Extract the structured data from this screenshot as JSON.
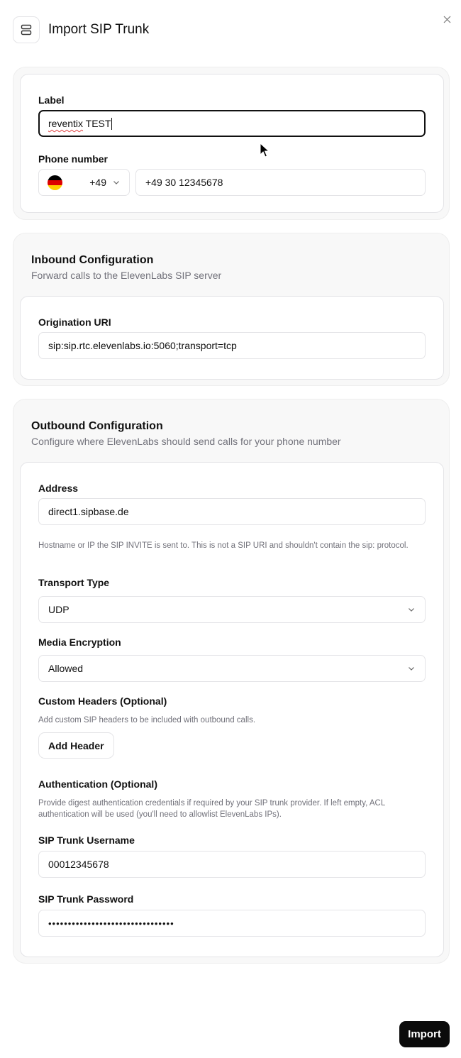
{
  "header": {
    "title": "Import SIP Trunk",
    "icon": "server-icon",
    "close_icon": "close-icon"
  },
  "basic": {
    "label_label": "Label",
    "label_value_word": "reventix",
    "label_value_rest": " TEST",
    "phone_label": "Phone number",
    "country_dial": "+49",
    "country_flag": "germany-flag",
    "flag_colors": [
      "#000000",
      "#dd0000",
      "#ffce00"
    ],
    "phone_value": "+49 30 12345678"
  },
  "inbound": {
    "title": "Inbound Configuration",
    "subtitle": "Forward calls to the ElevenLabs SIP server",
    "origination_label": "Origination URI",
    "origination_value": "sip:sip.rtc.elevenlabs.io:5060;transport=tcp"
  },
  "outbound": {
    "title": "Outbound Configuration",
    "subtitle": "Configure where ElevenLabs should send calls for your phone number",
    "address_label": "Address",
    "address_value": "direct1.sipbase.de",
    "address_help": "Hostname or IP the SIP INVITE is sent to. This is not a SIP URI and shouldn't contain the sip: protocol.",
    "transport_label": "Transport Type",
    "transport_value": "UDP",
    "media_label": "Media Encryption",
    "media_value": "Allowed",
    "headers_label": "Custom Headers (Optional)",
    "headers_help": "Add custom SIP headers to be included with outbound calls.",
    "add_header_label": "Add Header",
    "auth_label": "Authentication (Optional)",
    "auth_help": "Provide digest authentication credentials if required by your SIP trunk provider. If left empty, ACL authentication will be used (you'll need to allowlist ElevenLabs IPs).",
    "username_label": "SIP Trunk Username",
    "username_value": "00012345678",
    "password_label": "SIP Trunk Password",
    "password_value": "••••••••••••••••••••••••••••••••"
  },
  "footer": {
    "import_label": "Import"
  },
  "colors": {
    "primary": "#0b0b0b",
    "border": "#e4e4e7",
    "section_bg": "#f8f8f8",
    "muted": "#71717a"
  }
}
